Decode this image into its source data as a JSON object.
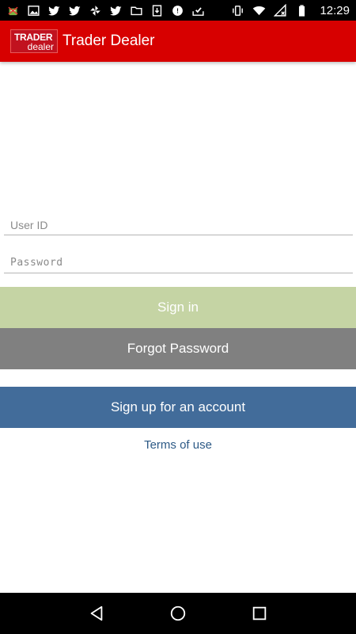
{
  "status_bar": {
    "time": "12:29",
    "left_icons": [
      "android-debug-icon",
      "image-icon",
      "twitter-icon",
      "twitter-icon",
      "pinwheel-icon",
      "twitter-icon",
      "folder-icon",
      "download-icon",
      "settings-badge-icon",
      "check-inbox-icon"
    ],
    "right_icons": [
      "vibrate-icon",
      "wifi-icon",
      "no-sim-icon",
      "battery-icon"
    ]
  },
  "app_bar": {
    "logo_line1": "TRADER",
    "logo_line2": "dealer",
    "title": "Trader Dealer",
    "color": "#d70000"
  },
  "form": {
    "user_id_placeholder": "User ID",
    "password_placeholder": "Password",
    "sign_in_label": "Sign in",
    "forgot_password_label": "Forgot Password",
    "sign_up_label": "Sign up for an account",
    "terms_label": "Terms of use"
  },
  "colors": {
    "sign_in": "#c5d4a4",
    "forgot": "#808080",
    "sign_up": "#426c9a",
    "link": "#2d5a86"
  },
  "nav_bar": {
    "icons": [
      "back-icon",
      "home-icon",
      "recents-icon"
    ]
  }
}
